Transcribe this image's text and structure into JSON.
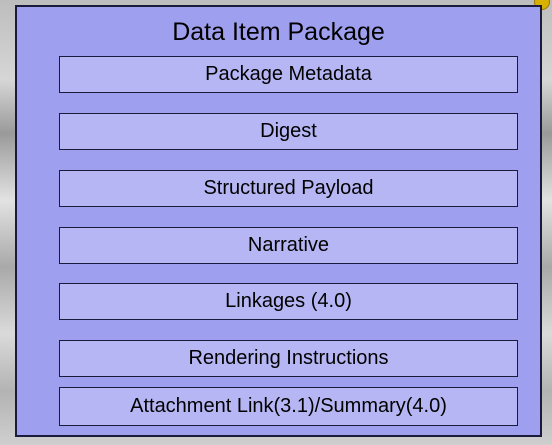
{
  "package": {
    "title": "Data Item Package",
    "components": [
      {
        "label": "Package Metadata"
      },
      {
        "label": "Digest"
      },
      {
        "label": "Structured Payload"
      },
      {
        "label": "Narrative"
      },
      {
        "label": "Linkages (4.0)"
      },
      {
        "label": "Rendering Instructions"
      },
      {
        "label": "Attachment Link(3.1)/Summary(4.0)"
      }
    ]
  },
  "colors": {
    "package_fill": "#9f9fef",
    "component_fill": "#b6b6f4",
    "border": "#1a1a3a"
  }
}
